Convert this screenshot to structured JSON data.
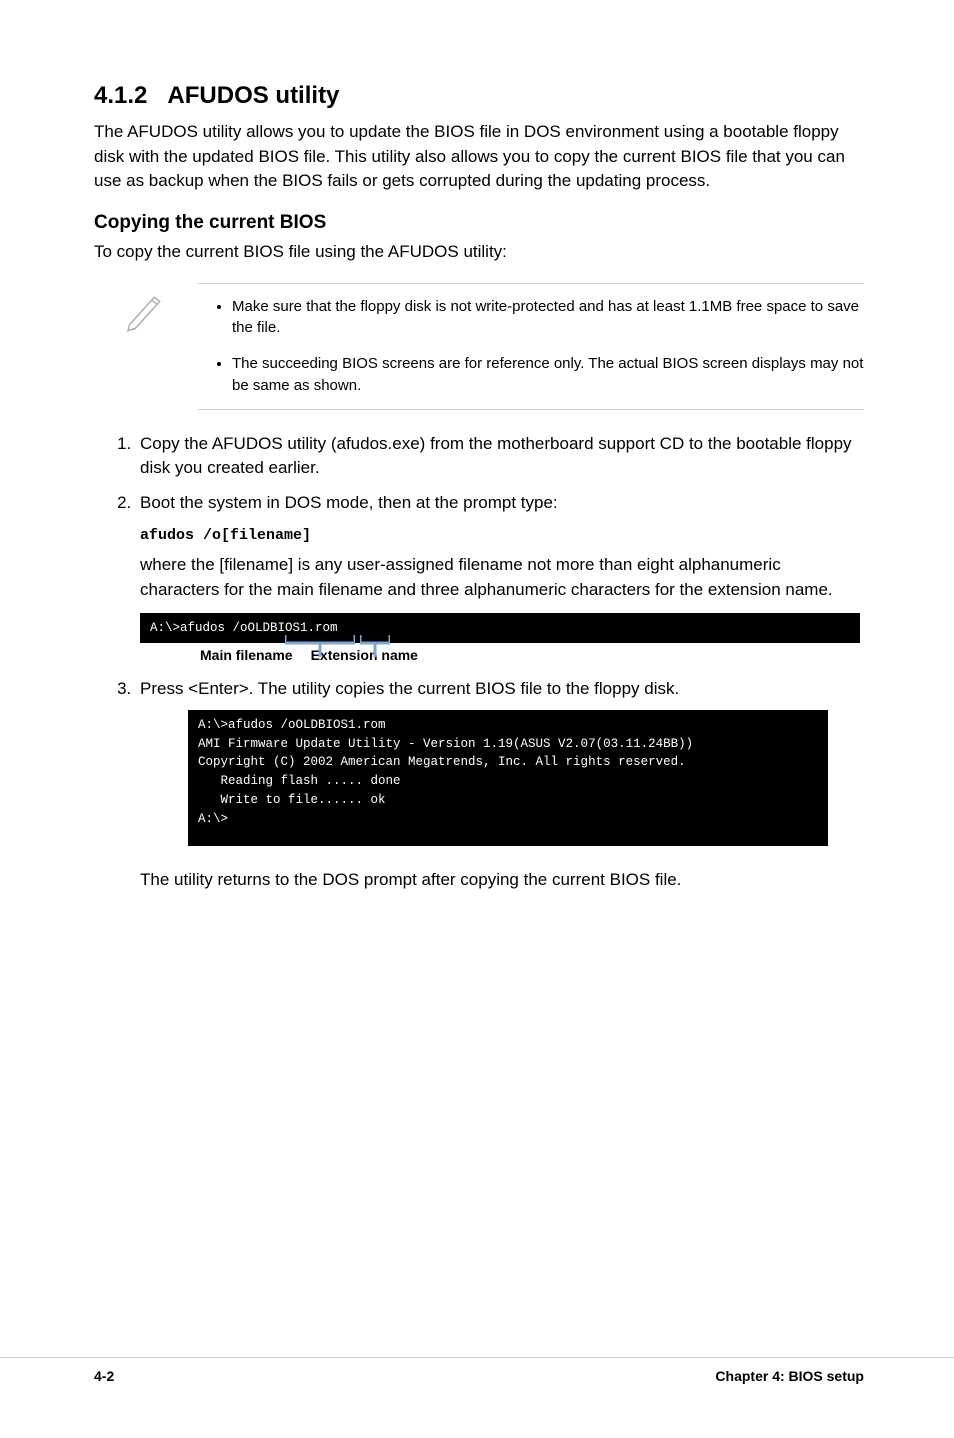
{
  "section": {
    "number": "4.1.2",
    "title": "AFUDOS utility",
    "intro": "The AFUDOS utility allows you to update the BIOS file in DOS environment using a bootable floppy disk with the updated BIOS file. This utility also allows you to copy the current BIOS file that you can use as backup when the BIOS fails or gets corrupted during the updating process."
  },
  "subsection": {
    "title": "Copying the current BIOS",
    "lead": "To copy the current BIOS file using the AFUDOS utility:"
  },
  "info": {
    "items": [
      "Make sure that the floppy disk is not write-protected and has at least 1.1MB free space to save the file.",
      "The succeeding BIOS screens are for reference only. The actual BIOS screen displays may not be same as shown."
    ]
  },
  "steps": {
    "s1": "Copy the AFUDOS utility (afudos.exe) from the motherboard support CD to the bootable floppy disk you created earlier.",
    "s2": "Boot the system in DOS mode, then at the prompt type:",
    "s2_cmd": "afudos /o[filename]",
    "s2_expl": "where the [filename] is any user-assigned filename not more than eight alphanumeric characters  for the main filename and three alphanumeric characters for the extension name.",
    "s3": "Press <Enter>. The utility copies the current BIOS file to the floppy disk."
  },
  "terminal1": {
    "line": "A:\\>afudos /oOLDBIOS1.rom"
  },
  "legend": {
    "main": "Main filename",
    "ext": "Extension name"
  },
  "terminal2": {
    "l1": "A:\\>afudos /oOLDBIOS1.rom",
    "l2": "AMI Firmware Update Utility - Version 1.19(ASUS V2.07(03.11.24BB))",
    "l3": "Copyright (C) 2002 American Megatrends, Inc. All rights reserved.",
    "l4": "   Reading flash ..... done",
    "l5": "   Write to file...... ok",
    "l6": "A:\\>"
  },
  "final": "The utility returns to the DOS prompt after copying the current BIOS file.",
  "footer": {
    "left": "4-2",
    "right": "Chapter 4:  BIOS setup"
  }
}
